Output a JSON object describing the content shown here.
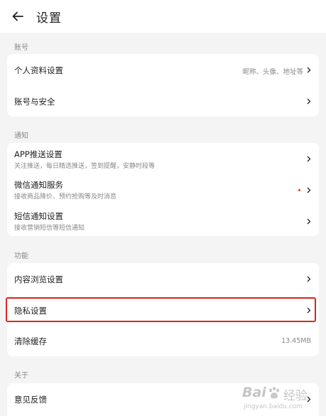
{
  "header": {
    "title": "设置",
    "back_icon": "arrow-left-icon"
  },
  "sections": {
    "account": {
      "label": "账号",
      "items": [
        {
          "title": "个人资料设置",
          "detail": "昵称、头像、地址等"
        },
        {
          "title": "账号与安全"
        }
      ]
    },
    "notify": {
      "label": "通知",
      "items": [
        {
          "title": "APP推送设置",
          "subtitle": "关注推送，每日精选推送，签到提醒，安静时段等"
        },
        {
          "title": "微信通知服务",
          "subtitle": "接收商品降价、预约抢购等及时消息"
        },
        {
          "title": "短信通知设置",
          "subtitle": "接收营销短信等短信通知"
        }
      ]
    },
    "feature": {
      "label": "功能",
      "items": [
        {
          "title": "内容浏览设置"
        },
        {
          "title": "隐私设置"
        },
        {
          "title": "清除缓存",
          "detail": "13.45MB"
        }
      ]
    },
    "about": {
      "label": "关于",
      "items": [
        {
          "title": "意见反馈"
        }
      ]
    }
  },
  "watermark": {
    "brand": "Bai",
    "brand_cn": "经验",
    "url": "jingyan.baidu.com"
  },
  "colors": {
    "highlight": "#d9261c",
    "badge_dot": "#e8341c",
    "background": "#f4f4f4"
  }
}
